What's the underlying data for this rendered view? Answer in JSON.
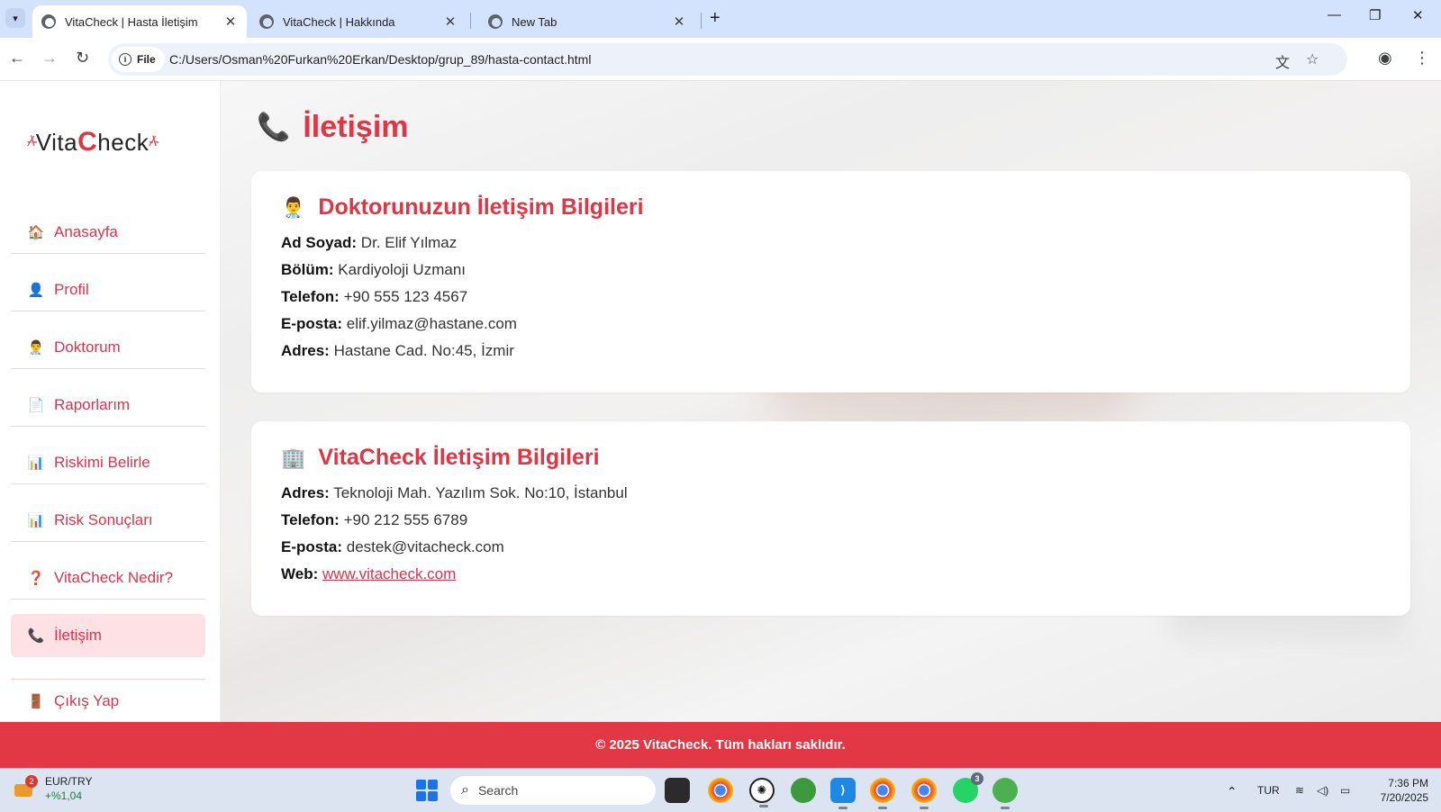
{
  "browser": {
    "tabs": [
      {
        "title": "VitaCheck | Hasta İletişim",
        "active": true
      },
      {
        "title": "VitaCheck | Hakkında",
        "active": false
      },
      {
        "title": "New Tab",
        "active": false
      }
    ],
    "chip_label": "File",
    "url": "C:/Users/Osman%20Furkan%20Erkan/Desktop/grup_89/hasta-contact.html"
  },
  "sidebar": {
    "logo_prefix": "Vita",
    "logo_c": "C",
    "logo_suffix": "heck",
    "items": [
      {
        "icon": "🏠",
        "icon_name": "home-icon",
        "label": "Anasayfa",
        "active": false
      },
      {
        "icon": "👤",
        "icon_name": "user-icon",
        "label": "Profil",
        "active": false
      },
      {
        "icon": "👨‍⚕️",
        "icon_name": "doctor-icon",
        "label": "Doktorum",
        "active": false
      },
      {
        "icon": "📄",
        "icon_name": "document-icon",
        "label": "Raporlarım",
        "active": false
      },
      {
        "icon": "📊",
        "icon_name": "chart-icon",
        "label": "Riskimi Belirle",
        "active": false
      },
      {
        "icon": "📊",
        "icon_name": "chart-icon",
        "label": "Risk Sonuçları",
        "active": false
      },
      {
        "icon": "❓",
        "icon_name": "question-icon",
        "label": "VitaCheck Nedir?",
        "active": false
      },
      {
        "icon": "📞",
        "icon_name": "phone-icon",
        "label": "İletişim",
        "active": true
      },
      {
        "icon": "🚪",
        "icon_name": "door-icon",
        "label": "Çıkış Yap",
        "active": false
      }
    ]
  },
  "main": {
    "title_icon": "📞",
    "title": "İletişim",
    "doctor_card": {
      "icon": "👨‍⚕️",
      "title": "Doktorunuzun İletişim Bilgileri",
      "rows": [
        {
          "label": "Ad Soyad:",
          "value": "Dr. Elif Yılmaz"
        },
        {
          "label": "Bölüm:",
          "value": "Kardiyoloji Uzmanı"
        },
        {
          "label": "Telefon:",
          "value": "+90 555 123 4567"
        },
        {
          "label": "E-posta:",
          "value": "elif.yilmaz@hastane.com"
        },
        {
          "label": "Adres:",
          "value": "Hastane Cad. No:45, İzmir"
        }
      ]
    },
    "company_card": {
      "icon": "🏢",
      "title": "VitaCheck İletişim Bilgileri",
      "rows": [
        {
          "label": "Adres:",
          "value": "Teknoloji Mah. Yazılım Sok. No:10, İstanbul"
        },
        {
          "label": "Telefon:",
          "value": "+90 212 555 6789"
        },
        {
          "label": "E-posta:",
          "value": "destek@vitacheck.com"
        }
      ],
      "web_label": "Web:",
      "web_link": "www.vitacheck.com"
    }
  },
  "footer": {
    "text": "© 2025 VitaCheck. Tüm hakları saklıdır."
  },
  "taskbar": {
    "widget_badge": "2",
    "widget_title": "EUR/TRY",
    "widget_change": "+%1,04",
    "search_placeholder": "Search",
    "whatsapp_badge": "3",
    "language": "TUR",
    "time": "7:36 PM",
    "date": "7/20/2025"
  },
  "colors": {
    "accent": "#e03545",
    "footer": "#e23744",
    "active_menu_bg": "#fde1e5"
  }
}
